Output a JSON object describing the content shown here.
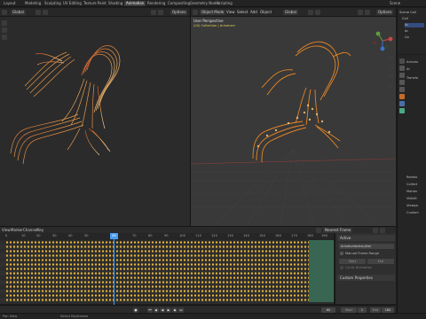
{
  "topbar": {
    "tabs": [
      "Layout",
      "Modeling",
      "Sculpting",
      "UV Editing",
      "Texture Paint",
      "Shading",
      "Animation",
      "Rendering",
      "Compositing",
      "Geometry Nodes",
      "Scripting"
    ],
    "active_tab": "Animation",
    "scene_label": "Scene"
  },
  "left_header": {
    "orientation": "Global",
    "options": "Options"
  },
  "right_header": {
    "mode": "Object Mode",
    "menus": [
      "View",
      "Select",
      "Add",
      "Object"
    ],
    "orientation": "Global",
    "options": "Options",
    "view_title": "User Perspective",
    "view_subtitle": "(00) Collection | Armature"
  },
  "outliner": {
    "rows": [
      "Scene Coll",
      "Coll",
      "Ar",
      "Ar",
      "Ca"
    ]
  },
  "properties": {
    "rows": [
      "Armatu",
      "Ar",
      "Transfo",
      "Relatio",
      "Collect",
      "Motion",
      "Visibili",
      "Viewpo",
      "Custom"
    ]
  },
  "dopesheet": {
    "menus": [
      "View",
      "Marker",
      "Channel",
      "Key"
    ],
    "nearest_frame": "Nearest Frame",
    "ruler_ticks": [
      "0",
      "10",
      "20",
      "30",
      "40",
      "50",
      "60",
      "70",
      "80",
      "90",
      "100",
      "110",
      "120",
      "130",
      "140",
      "150",
      "160",
      "170",
      "180",
      "190"
    ],
    "current_frame": "60",
    "row_count": 14
  },
  "side_panel": {
    "active_header": "Active",
    "action_name": "ArmatureAction|Hair",
    "manual_frame_range": "Manual Frame Range",
    "start_label": "Start",
    "end_label": "End",
    "cyclic_label": "Cyclic Animation",
    "custom_properties": "Custom Properties"
  },
  "playbar": {
    "frame": "60",
    "start_label": "Start",
    "start_value": "1",
    "end_label": "End",
    "end_value": "180"
  },
  "statusbar": {
    "left": "Pan View",
    "middle": "Select Keyframes"
  },
  "colors": {
    "keyframe": "#e8b73c",
    "playhead": "#4a9df0",
    "hair_orange": "#f08a24",
    "hair_cream": "#f3d9a0"
  }
}
